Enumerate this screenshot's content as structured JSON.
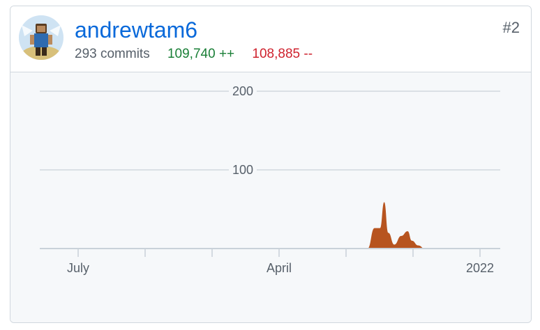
{
  "contributor": {
    "username": "andrewtam6",
    "rank": "#2",
    "commits": "293 commits",
    "additions": "109,740 ++",
    "deletions": "108,885 --",
    "avatar_icon": "avatar-image"
  },
  "colors": {
    "link": "#0969da",
    "additions": "#1a7f37",
    "deletions": "#cf222e",
    "area_fill": "#b7541f"
  },
  "chart_data": {
    "type": "area",
    "y_ticks": [
      "100",
      "200"
    ],
    "x_ticks": [
      "July",
      "April",
      "2022"
    ],
    "ylim": [
      0,
      200
    ],
    "grid": true,
    "series": [
      {
        "x": [
          0,
          1,
          2,
          3,
          4,
          5,
          6,
          7,
          8,
          9,
          10,
          11,
          12,
          13,
          14,
          15,
          16,
          17,
          18,
          19,
          20,
          21
        ],
        "values": [
          0,
          0,
          0,
          0,
          0,
          0,
          0,
          0,
          0,
          0,
          0,
          0,
          0,
          0,
          0,
          0,
          0,
          0,
          0,
          0,
          0,
          0
        ]
      }
    ],
    "x_range": [
      0,
      1
    ],
    "peaks": [
      {
        "x": 0.712,
        "y": 0
      },
      {
        "x": 0.727,
        "y": 26
      },
      {
        "x": 0.739,
        "y": 26
      },
      {
        "x": 0.748,
        "y": 59
      },
      {
        "x": 0.757,
        "y": 20
      },
      {
        "x": 0.77,
        "y": 5
      },
      {
        "x": 0.785,
        "y": 16
      },
      {
        "x": 0.799,
        "y": 22
      },
      {
        "x": 0.808,
        "y": 10
      },
      {
        "x": 0.822,
        "y": 4
      },
      {
        "x": 0.836,
        "y": 0
      }
    ]
  }
}
